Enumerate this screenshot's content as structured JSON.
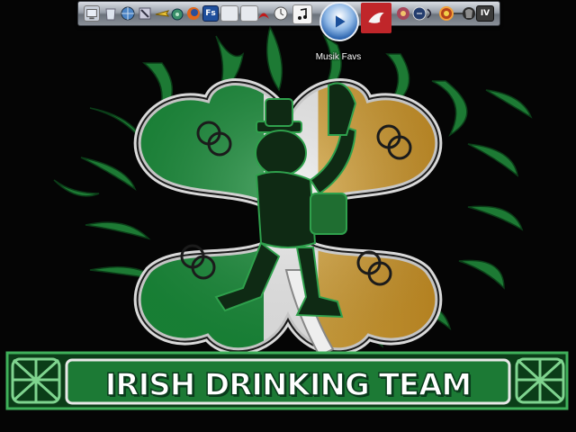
{
  "desktop": {
    "wallpaper_text": "IRISH DRINKING TEAM"
  },
  "dock": {
    "hover_label": "Musik Favs",
    "icons": [
      "desktop-icon",
      "recycle-bin-icon",
      "network-icon",
      "tools-icon",
      "airplane-icon",
      "shell-icon",
      "firefox-icon",
      "fs-icon",
      "window-icon",
      "window-icon-2",
      "pdf-icon",
      "clock-icon",
      "itunes-icon",
      "media-player-icon",
      "bird-icon",
      "photo-icon",
      "emblem-icon",
      "cd-icon",
      "sun-icon",
      "pipe-icon",
      "gamer-icon",
      "roman-numeral-icon"
    ],
    "fs_label": "Fs",
    "numeral_label": "IV"
  },
  "colors": {
    "irish_green": "#1a8c3a",
    "irish_orange": "#d4a33a",
    "shamrock_white": "#f2f2f2",
    "tribal_green": "#1d7a34",
    "background": "#050505"
  }
}
